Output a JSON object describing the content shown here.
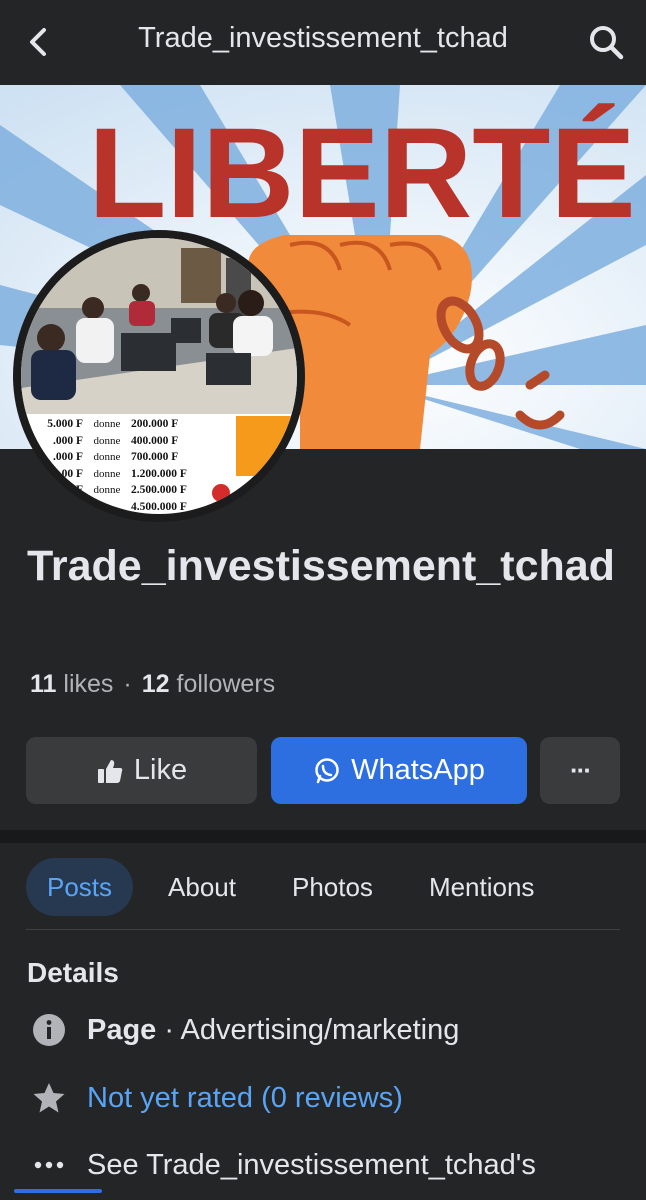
{
  "topbar": {
    "title": "Trade_investissement_tchad",
    "back_icon": "chevron-left-icon",
    "search_icon": "search-icon"
  },
  "cover": {
    "headline": "LIBERTÉ"
  },
  "avatar": {
    "price_list": [
      {
        "amount": "5.000 F",
        "word": "donne",
        "result": "200.000 F"
      },
      {
        "amount": ".000 F",
        "word": "donne",
        "result": "400.000 F"
      },
      {
        "amount": ".000 F",
        "word": "donne",
        "result": "700.000 F"
      },
      {
        "amount": "00 F",
        "word": "donne",
        "result": "1.200.000 F"
      },
      {
        "amount": "F",
        "word": "donne",
        "result": "2.500.000 F"
      },
      {
        "amount": "",
        "word": "",
        "result": "4.500.000 F"
      }
    ]
  },
  "page": {
    "name": "Trade_investissement_tchad",
    "likes_count": "11",
    "likes_label": "likes",
    "followers_count": "12",
    "followers_label": "followers"
  },
  "actions": {
    "like_label": "Like",
    "whatsapp_label": "WhatsApp",
    "more_label": "···"
  },
  "tabs": [
    {
      "label": "Posts",
      "active": true
    },
    {
      "label": "About",
      "active": false
    },
    {
      "label": "Photos",
      "active": false
    },
    {
      "label": "Mentions",
      "active": false
    }
  ],
  "details": {
    "title": "Details",
    "page_label": "Page",
    "category": " · Advertising/marketing",
    "rating": "Not yet rated (0 reviews)",
    "see_more": "See Trade_investissement_tchad's"
  },
  "colors": {
    "background": "#242526",
    "accent_blue": "#2d6fe0",
    "link_blue": "#5aa4f5",
    "button_gray": "#3a3b3c"
  }
}
